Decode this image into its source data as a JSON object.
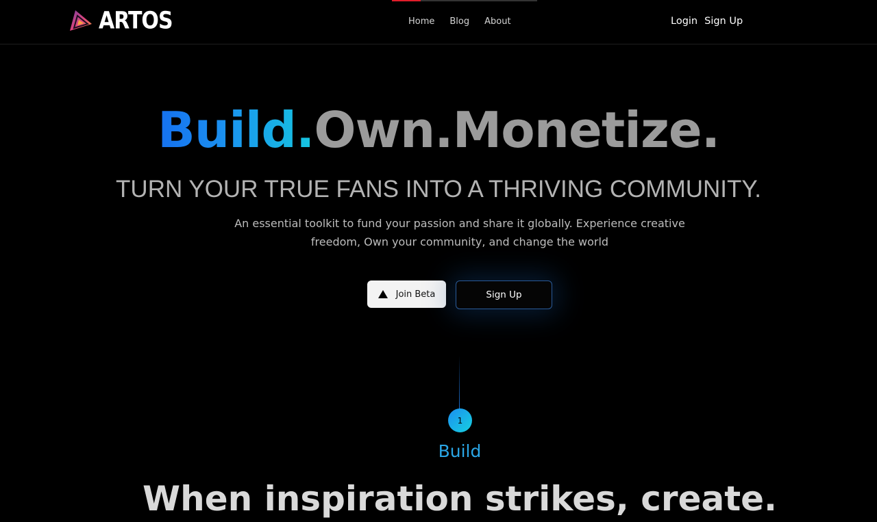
{
  "brand": {
    "name": "ARTOS",
    "logo_colors": [
      "#7b3fa0",
      "#e0457b",
      "#f59e42"
    ]
  },
  "nav": {
    "items": [
      {
        "label": "Home"
      },
      {
        "label": "Blog"
      },
      {
        "label": "About"
      }
    ]
  },
  "auth": {
    "login_label": "Login",
    "signup_label": "Sign Up"
  },
  "hero": {
    "title_build": "Build.",
    "title_rest": "Own.Monetize.",
    "subtitle": "TURN YOUR TRUE FANS INTO A THRIVING COMMUNITY.",
    "description": "An essential toolkit to fund your passion and share it globally. Experience creative freedom, Own your community, and change the world",
    "join_beta_label": "Join Beta",
    "join_beta_icon": "triangle-icon",
    "signup_label": "Sign Up"
  },
  "step": {
    "number": "1",
    "label": "Build",
    "heading": "When inspiration strikes, create."
  },
  "colors": {
    "background": "#000000",
    "accent_blue": "#1b8ff0",
    "accent_cyan": "#16c6e0",
    "muted_text": "#9b9b9b"
  }
}
